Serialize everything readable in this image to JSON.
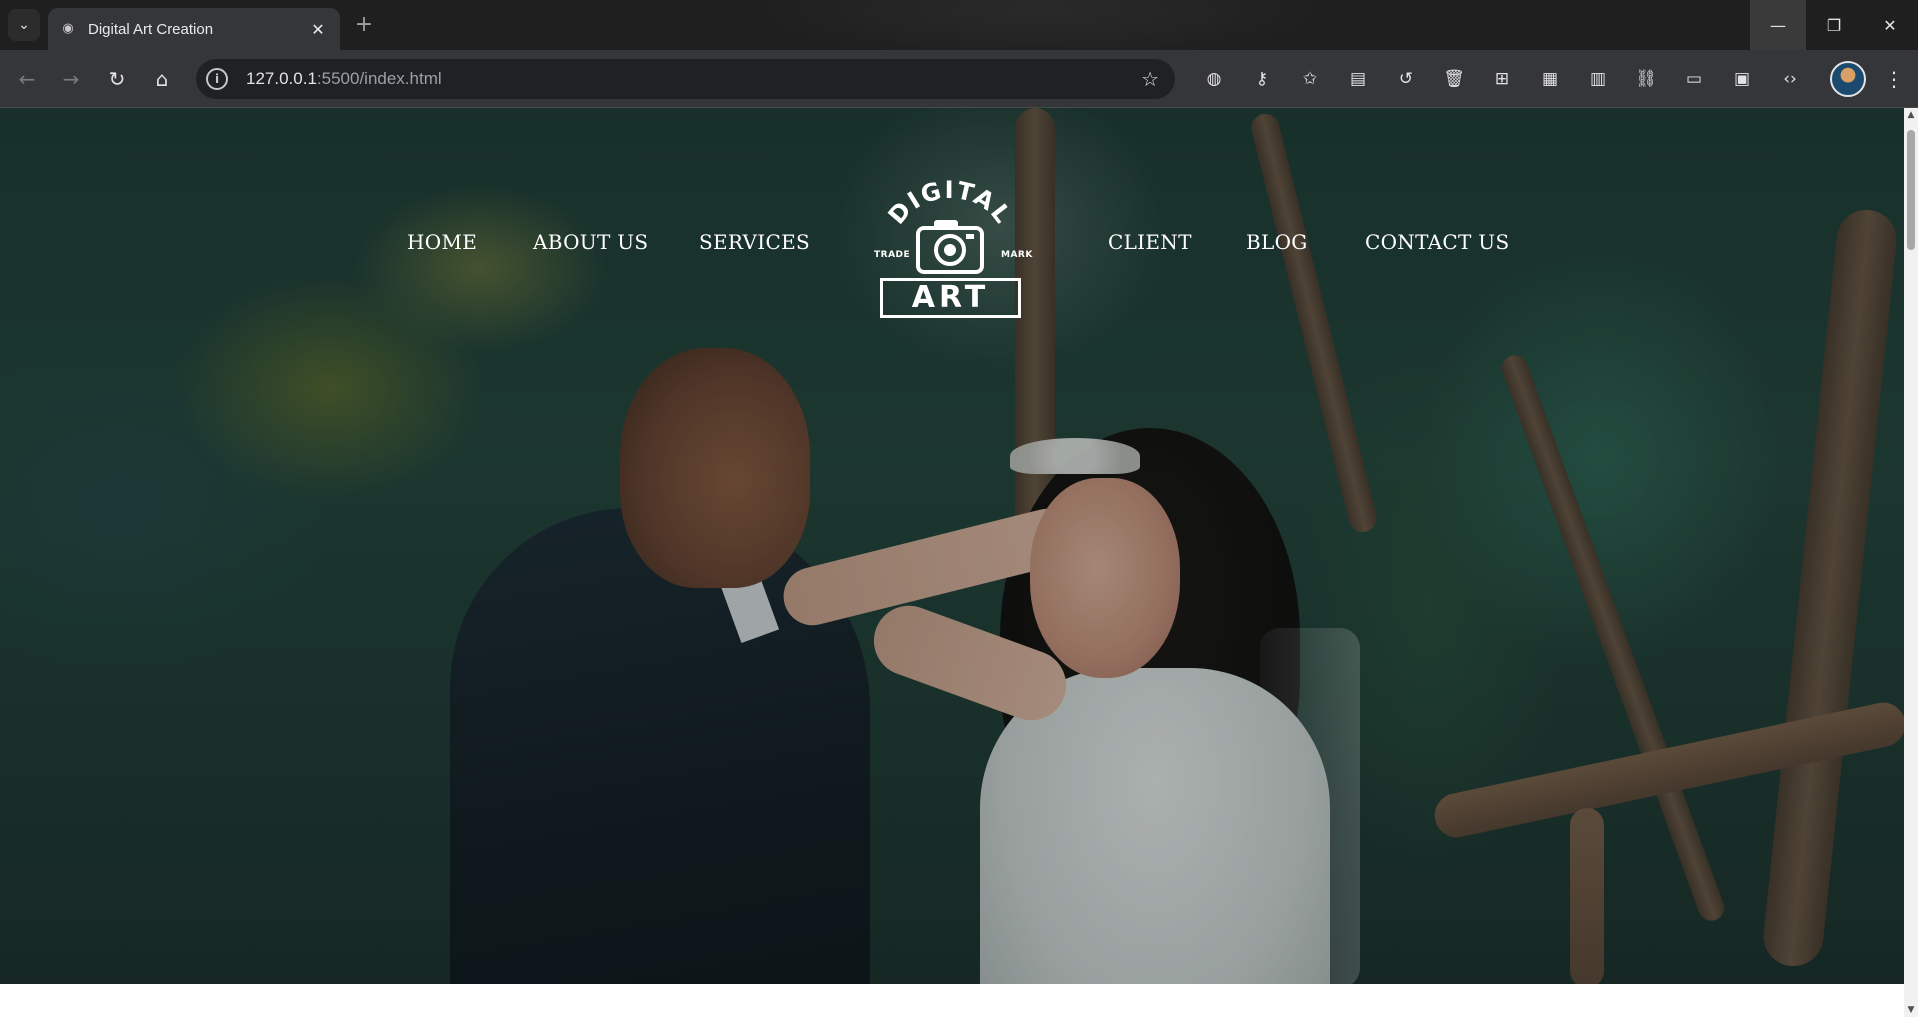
{
  "browser": {
    "tab": {
      "title": "Digital Art Creation",
      "favicon_icon": "incognito-icon"
    },
    "omnibox": {
      "host": "127.0.0.1",
      "path": ":5500/index.html"
    },
    "window_controls": [
      "minimize",
      "restore",
      "close"
    ],
    "extension_icons": [
      "incognito-icon",
      "key-icon",
      "star-list-icon",
      "reading-list-icon",
      "history-icon",
      "trash-icon",
      "translate-icon",
      "qr-code-icon",
      "reader-mode-icon",
      "link-icon",
      "devices-icon",
      "layout-icon",
      "code-icon"
    ]
  },
  "site": {
    "nav_left": [
      "HOME",
      "ABOUT US",
      "SERVICES"
    ],
    "nav_right": [
      "CLIENT",
      "BLOG",
      "CONTACT US"
    ],
    "logo": {
      "arc_text": "DIGITAL",
      "left_text": "TRADE",
      "right_text": "MARK",
      "main_text": "ART"
    }
  },
  "colors": {
    "nav_text": "#ffffff",
    "chrome_bg": "#35363a",
    "titlebar_bg": "#1f1f1f"
  }
}
